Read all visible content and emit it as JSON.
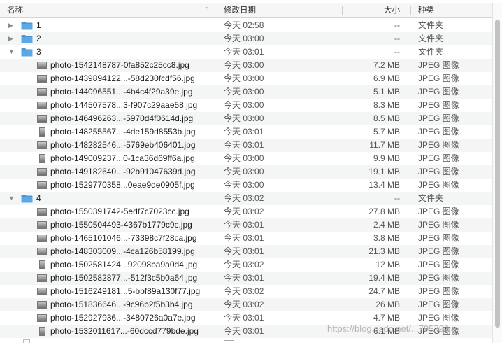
{
  "header": {
    "name": "名称",
    "date": "修改日期",
    "size": "大小",
    "kind": "种类",
    "sort_arrow": "⌃"
  },
  "colors": {
    "folder": "#5aa9e6",
    "folder_tab": "#4a96d3"
  },
  "rows": [
    {
      "type": "folder",
      "disc": "▶",
      "name": "1",
      "date": "今天 02:58",
      "size": "--",
      "kind": "文件夹"
    },
    {
      "type": "folder",
      "disc": "▶",
      "name": "2",
      "date": "今天 03:00",
      "size": "--",
      "kind": "文件夹"
    },
    {
      "type": "folder",
      "disc": "▼",
      "name": "3",
      "date": "今天 03:01",
      "size": "--",
      "kind": "文件夹"
    },
    {
      "type": "file",
      "name": "photo-1542148787-0fa852c25cc8.jpg",
      "date": "今天 03:00",
      "size": "7.2 MB",
      "kind": "JPEG 图像"
    },
    {
      "type": "file",
      "name": "photo-1439894122...-58d230fcdf56.jpg",
      "date": "今天 03:00",
      "size": "6.9 MB",
      "kind": "JPEG 图像"
    },
    {
      "type": "file",
      "name": "photo-144096551...-4b4c4f29a39e.jpg",
      "date": "今天 03:00",
      "size": "5.1 MB",
      "kind": "JPEG 图像"
    },
    {
      "type": "file",
      "name": "photo-144507578...3-f907c29aae58.jpg",
      "date": "今天 03:00",
      "size": "8.3 MB",
      "kind": "JPEG 图像"
    },
    {
      "type": "file",
      "name": "photo-146496263...-5970d4f0614d.jpg",
      "date": "今天 03:00",
      "size": "8.5 MB",
      "kind": "JPEG 图像"
    },
    {
      "type": "file",
      "name": "photo-148255567...-4de159d8553b.jpg",
      "date": "今天 03:01",
      "size": "5.7 MB",
      "kind": "JPEG 图像",
      "vertical": true
    },
    {
      "type": "file",
      "name": "photo-148282546...-5769eb406401.jpg",
      "date": "今天 03:01",
      "size": "11.7 MB",
      "kind": "JPEG 图像"
    },
    {
      "type": "file",
      "name": "photo-149009237...0-1ca36d69ff6a.jpg",
      "date": "今天 03:00",
      "size": "9.9 MB",
      "kind": "JPEG 图像",
      "vertical": true
    },
    {
      "type": "file",
      "name": "photo-149182640...-92b91047639d.jpg",
      "date": "今天 03:00",
      "size": "19.1 MB",
      "kind": "JPEG 图像"
    },
    {
      "type": "file",
      "name": "photo-1529770358...0eae9de0905f.jpg",
      "date": "今天 03:00",
      "size": "13.4 MB",
      "kind": "JPEG 图像"
    },
    {
      "type": "folder",
      "disc": "▼",
      "name": "4",
      "date": "今天 03:02",
      "size": "--",
      "kind": "文件夹"
    },
    {
      "type": "file",
      "name": "photo-1550391742-5edf7c7023cc.jpg",
      "date": "今天 03:02",
      "size": "27.8 MB",
      "kind": "JPEG 图像"
    },
    {
      "type": "file",
      "name": "photo-1550504493-4367b1779c9c.jpg",
      "date": "今天 03:01",
      "size": "2.4 MB",
      "kind": "JPEG 图像"
    },
    {
      "type": "file",
      "name": "photo-1465101046...-73398c7f28ca.jpg",
      "date": "今天 03:01",
      "size": "3.8 MB",
      "kind": "JPEG 图像"
    },
    {
      "type": "file",
      "name": "photo-148303009...-4ca126b58199.jpg",
      "date": "今天 03:01",
      "size": "21.3 MB",
      "kind": "JPEG 图像"
    },
    {
      "type": "file",
      "name": "photo-1502581424...92098ba9a0d4.jpg",
      "date": "今天 03:02",
      "size": "12 MB",
      "kind": "JPEG 图像",
      "vertical": true
    },
    {
      "type": "file",
      "name": "photo-1502582877...-512f3c5b0a64.jpg",
      "date": "今天 03:01",
      "size": "19.4 MB",
      "kind": "JPEG 图像"
    },
    {
      "type": "file",
      "name": "photo-1516249181...5-bbf89a130f77.jpg",
      "date": "今天 03:02",
      "size": "24.7 MB",
      "kind": "JPEG 图像"
    },
    {
      "type": "file",
      "name": "photo-151836646...-9c96b2f5b3b4.jpg",
      "date": "今天 03:02",
      "size": "26 MB",
      "kind": "JPEG 图像"
    },
    {
      "type": "file",
      "name": "photo-152927936...-3480726a0a7e.jpg",
      "date": "今天 03:01",
      "size": "4.7 MB",
      "kind": "JPEG 图像"
    },
    {
      "type": "file",
      "name": "photo-1532011617...-60dccd779bde.jpg",
      "date": "今天 03:01",
      "size": "6.1 MB",
      "kind": "JPEG 图像",
      "vertical": true
    }
  ],
  "watermark": "https://blog.csdn.net/...795790"
}
